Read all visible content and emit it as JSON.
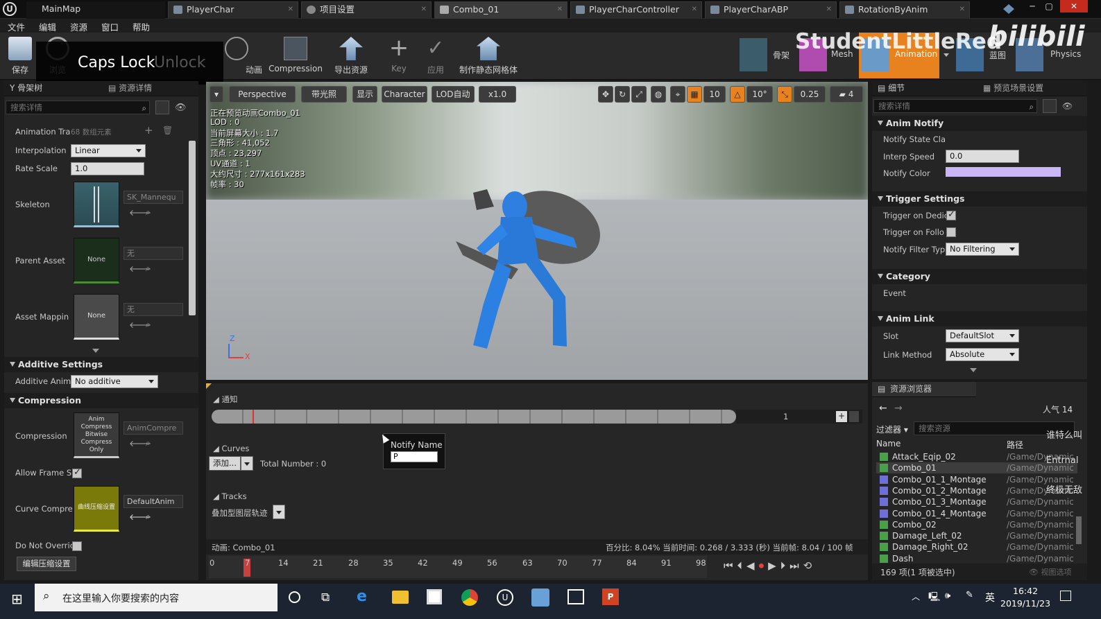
{
  "tabs": [
    {
      "label": "MainMap"
    },
    {
      "label": "PlayerChar"
    },
    {
      "label": "项目设置"
    },
    {
      "label": "Combo_01"
    },
    {
      "label": "PlayerCharController"
    },
    {
      "label": "PlayerCharABP"
    },
    {
      "label": "RotationByAnim"
    }
  ],
  "menu": [
    "文件",
    "编辑",
    "资源",
    "窗口",
    "帮助"
  ],
  "toolbar": {
    "save": "保存",
    "browse": "浏览",
    "anim": "动画",
    "compression": "Compression",
    "export": "导出资源",
    "key": "Key",
    "apply": "应用",
    "make_static": "制作静态网格体",
    "skeleton": "骨架",
    "mesh": "Mesh",
    "animation": "Animation",
    "blueprint": "蓝图",
    "physics": "Physics"
  },
  "overlay": {
    "caps": "Caps Lock",
    "unlock": "Unlock",
    "watermark": "StudentLittleRed",
    "bili": "bilibili",
    "danmu1": "谁特么叫",
    "danmu2": "Entrnal",
    "danmu3": "终极无敌"
  },
  "left": {
    "tab_skeleton": "骨架树",
    "tab_details": "资源详情",
    "search": "搜索详情",
    "anim_track": "Animation Tra",
    "anim_track_count": "68 数组元素",
    "interp_label": "Interpolation",
    "interp_value": "Linear",
    "rate_label": "Rate Scale",
    "rate_value": "1.0",
    "skeleton_label": "Skeleton",
    "skeleton_value": "SK_Mannequ",
    "parent_label": "Parent Asset",
    "parent_thumb": "None",
    "parent_value": "无",
    "mapping_label": "Asset Mappin",
    "mapping_thumb": "None",
    "mapping_value": "无",
    "additive_section": "Additive Settings",
    "additive_label": "Additive Anim",
    "additive_value": "No additive",
    "compression_section": "Compression",
    "compression_label": "Compression",
    "compression_thumb": "Anim Compress Bitwise Compress Only",
    "compression_value": "AnimCompre",
    "allow_frame": "Allow Frame S",
    "curve_label": "Curve Compre",
    "curve_thumb": "曲线压缩设置",
    "curve_value": "DefaultAnim",
    "do_not": "Do Not Overric",
    "edit_btn": "编辑压缩设置"
  },
  "viewport": {
    "perspective": "Perspective",
    "lit": "带光照",
    "show": "显示",
    "character": "Character",
    "lod": "LOD自动",
    "speed": "x1.0",
    "grid": "10",
    "angle": "10°",
    "scale": "0.25",
    "cam": "4",
    "info": [
      "正在预览动画Combo_01",
      "LOD : 0",
      "当前屏幕大小 : 1.7",
      "三角形 : 41,052",
      "顶点 : 23,297",
      "UV通道 : 1",
      "大约尺寸 : 277x161x283",
      "帧率 : 30"
    ]
  },
  "timeline": {
    "notify": "通知",
    "track_num": "1",
    "curves": "Curves",
    "add": "添加...",
    "total": "Total Number : 0",
    "notify_name": "Notify Name",
    "notify_input": "P",
    "tracks": "Tracks",
    "additive_track": "叠加型图层轨迹",
    "anim_label": "动画: Combo_01",
    "status": "百分比: 8.04% 当前时间: 0.268 / 3.333 (秒) 当前帧: 8.04 / 100 帧",
    "ticks": [
      "0",
      "7",
      "14",
      "21",
      "28",
      "35",
      "42",
      "49",
      "56",
      "63",
      "70",
      "77",
      "84",
      "91",
      "98"
    ]
  },
  "right": {
    "tab_details": "细节",
    "tab_preview": "预览场景设置",
    "search": "搜索详情",
    "anim_notify": "Anim Notify",
    "notify_state": "Notify State Cla",
    "interp_speed": "Interp Speed",
    "interp_value": "0.0",
    "notify_color": "Notify Color",
    "trigger": "Trigger Settings",
    "trigger_dedic": "Trigger on Dedic",
    "trigger_follo": "Trigger on Follo",
    "filter": "Notify Filter Typ",
    "filter_value": "No Filtering",
    "category": "Category",
    "event": "Event",
    "anim_link": "Anim Link",
    "slot": "Slot",
    "slot_value": "DefaultSlot",
    "link_method": "Link Method",
    "link_value": "Absolute",
    "notify_color_hex": "#c9b6f5"
  },
  "browser": {
    "title": "资源浏览器",
    "people": "人气 14",
    "filter": "过滤器",
    "search": "搜索资源",
    "col_name": "Name",
    "col_path": "路径",
    "rows": [
      {
        "name": "Attack_Eqip_02",
        "path": "/Game/Dynamic",
        "kind": "anim"
      },
      {
        "name": "Combo_01",
        "path": "/Game/Dynamic",
        "kind": "anim"
      },
      {
        "name": "Combo_01_1_Montage",
        "path": "/Game/Dynamic",
        "kind": "montage"
      },
      {
        "name": "Combo_01_2_Montage",
        "path": "/Game/Dynamic",
        "kind": "montage"
      },
      {
        "name": "Combo_01_3_Montage",
        "path": "/Game/Dynamic",
        "kind": "montage"
      },
      {
        "name": "Combo_01_4_Montage",
        "path": "/Game/Dynamic",
        "kind": "montage"
      },
      {
        "name": "Combo_02",
        "path": "/Game/Dynamic",
        "kind": "anim"
      },
      {
        "name": "Damage_Left_02",
        "path": "/Game/Dynamic",
        "kind": "anim"
      },
      {
        "name": "Damage_Right_02",
        "path": "/Game/Dynamic",
        "kind": "anim"
      },
      {
        "name": "Dash",
        "path": "/Game/Dynamic",
        "kind": "anim"
      }
    ],
    "count": "169 项(1 项被选中)",
    "view": "视图选项"
  },
  "taskbar": {
    "search": "在这里输入你要搜索的内容",
    "ime": "英",
    "time": "16:42",
    "date": "2019/11/23"
  }
}
